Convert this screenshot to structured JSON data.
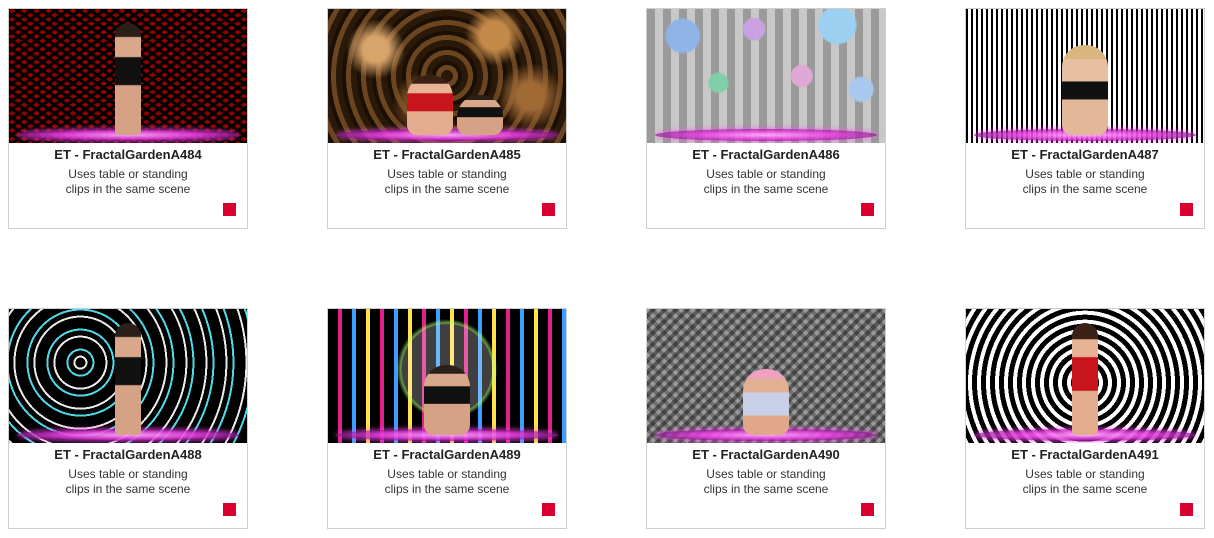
{
  "description": "Uses table or standing clips in the same scene",
  "cards": [
    {
      "title": "ET - FractalGardenA484",
      "desc_line1": "Uses table or standing",
      "desc_line2": "clips in the same scene"
    },
    {
      "title": "ET - FractalGardenA485",
      "desc_line1": "Uses table or standing",
      "desc_line2": "clips in the same scene"
    },
    {
      "title": "ET - FractalGardenA486",
      "desc_line1": "Uses table or standing",
      "desc_line2": "clips in the same scene"
    },
    {
      "title": "ET - FractalGardenA487",
      "desc_line1": "Uses table or standing",
      "desc_line2": "clips in the same scene"
    },
    {
      "title": "ET - FractalGardenA488",
      "desc_line1": "Uses table or standing",
      "desc_line2": "clips in the same scene"
    },
    {
      "title": "ET - FractalGardenA489",
      "desc_line1": "Uses table or standing",
      "desc_line2": "clips in the same scene"
    },
    {
      "title": "ET - FractalGardenA490",
      "desc_line1": "Uses table or standing",
      "desc_line2": "clips in the same scene"
    },
    {
      "title": "ET - FractalGardenA491",
      "desc_line1": "Uses table or standing",
      "desc_line2": "clips in the same scene"
    }
  ],
  "colors": {
    "badge": "#d8002e",
    "platform_glow": "#e23cdc"
  }
}
